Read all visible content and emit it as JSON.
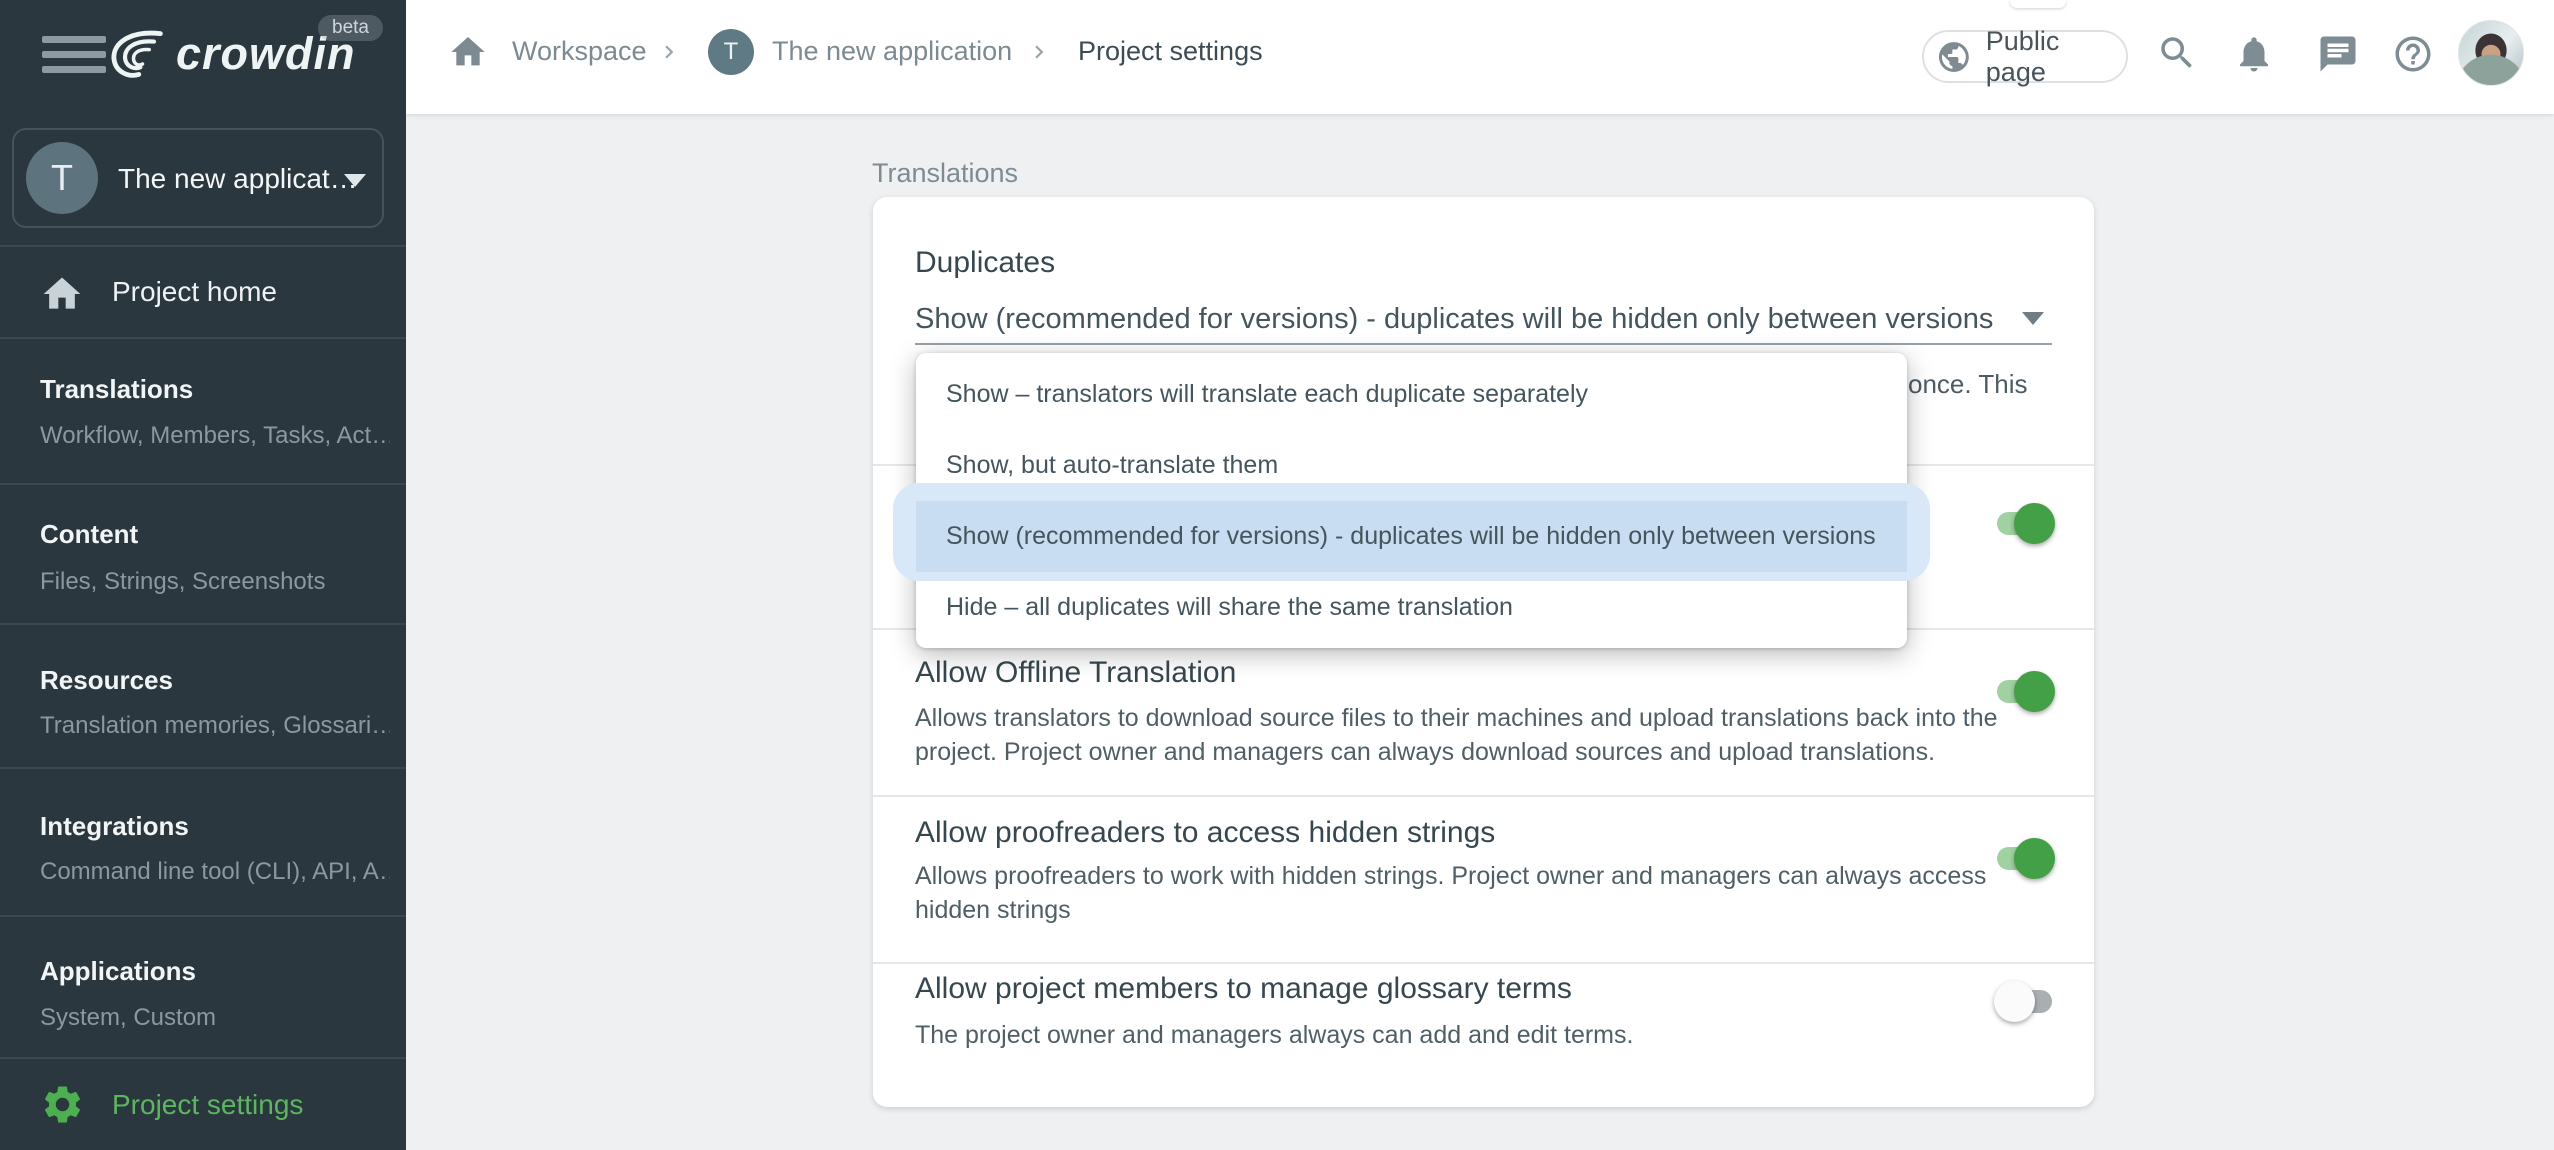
{
  "colors": {
    "sidebar_bg": "#2b373e",
    "accent_green": "#43a047",
    "sidebar_link_green": "#5cb660",
    "toggle_on_track": "#9fd1a1",
    "toggle_on_thumb": "#43a047",
    "toggle_off_track": "#a9aeb1",
    "dropdown_highlight_outer": "#d9e8f8",
    "dropdown_highlight_inner": "#c8ddf1"
  },
  "topbar": {
    "logo_text": "crowdin",
    "beta_badge": "beta",
    "breadcrumb": {
      "workspace": "Workspace",
      "project_initial": "T",
      "project_name": "The new application",
      "current_page": "Project settings"
    },
    "public_page_button": "Public page"
  },
  "sidebar": {
    "project_selector": {
      "initial": "T",
      "label": "The new applicat…"
    },
    "project_home": "Project home",
    "sections": [
      {
        "title": "Translations",
        "subtitle": "Workflow, Members, Tasks, Act…"
      },
      {
        "title": "Content",
        "subtitle": "Files, Strings, Screenshots"
      },
      {
        "title": "Resources",
        "subtitle": "Translation memories, Glossari…"
      },
      {
        "title": "Integrations",
        "subtitle": "Command line tool (CLI), API, A…"
      },
      {
        "title": "Applications",
        "subtitle": "System, Custom"
      }
    ],
    "project_settings": "Project settings"
  },
  "main": {
    "section_label": "Translations",
    "duplicates": {
      "title": "Duplicates",
      "select_value": "Show (recommended for versions) - duplicates will be hidden only between versions",
      "description_visible_fragment": "once. This",
      "dropdown_options": [
        {
          "label": "Show – translators will translate each duplicate separately",
          "selected": false
        },
        {
          "label": "Show, but auto-translate them",
          "selected": false
        },
        {
          "label": "Show (recommended for versions) - duplicates will be hidden only between versions",
          "selected": true
        },
        {
          "label": "Hide – all duplicates will share the same translation",
          "selected": false
        }
      ]
    },
    "settings_rows": [
      {
        "title": "",
        "description": "",
        "toggle": "on"
      },
      {
        "title": "Allow Offline Translation",
        "description": "Allows translators to download source files to their machines and upload translations back into the project. Project owner and managers can always download sources and upload translations.",
        "toggle": "on"
      },
      {
        "title": "Allow proofreaders to access hidden strings",
        "description": "Allows proofreaders to work with hidden strings. Project owner and managers can always access hidden strings",
        "toggle": "on"
      },
      {
        "title": "Allow project members to manage glossary terms",
        "description": "The project owner and managers always can add and edit terms.",
        "toggle": "off"
      }
    ]
  }
}
